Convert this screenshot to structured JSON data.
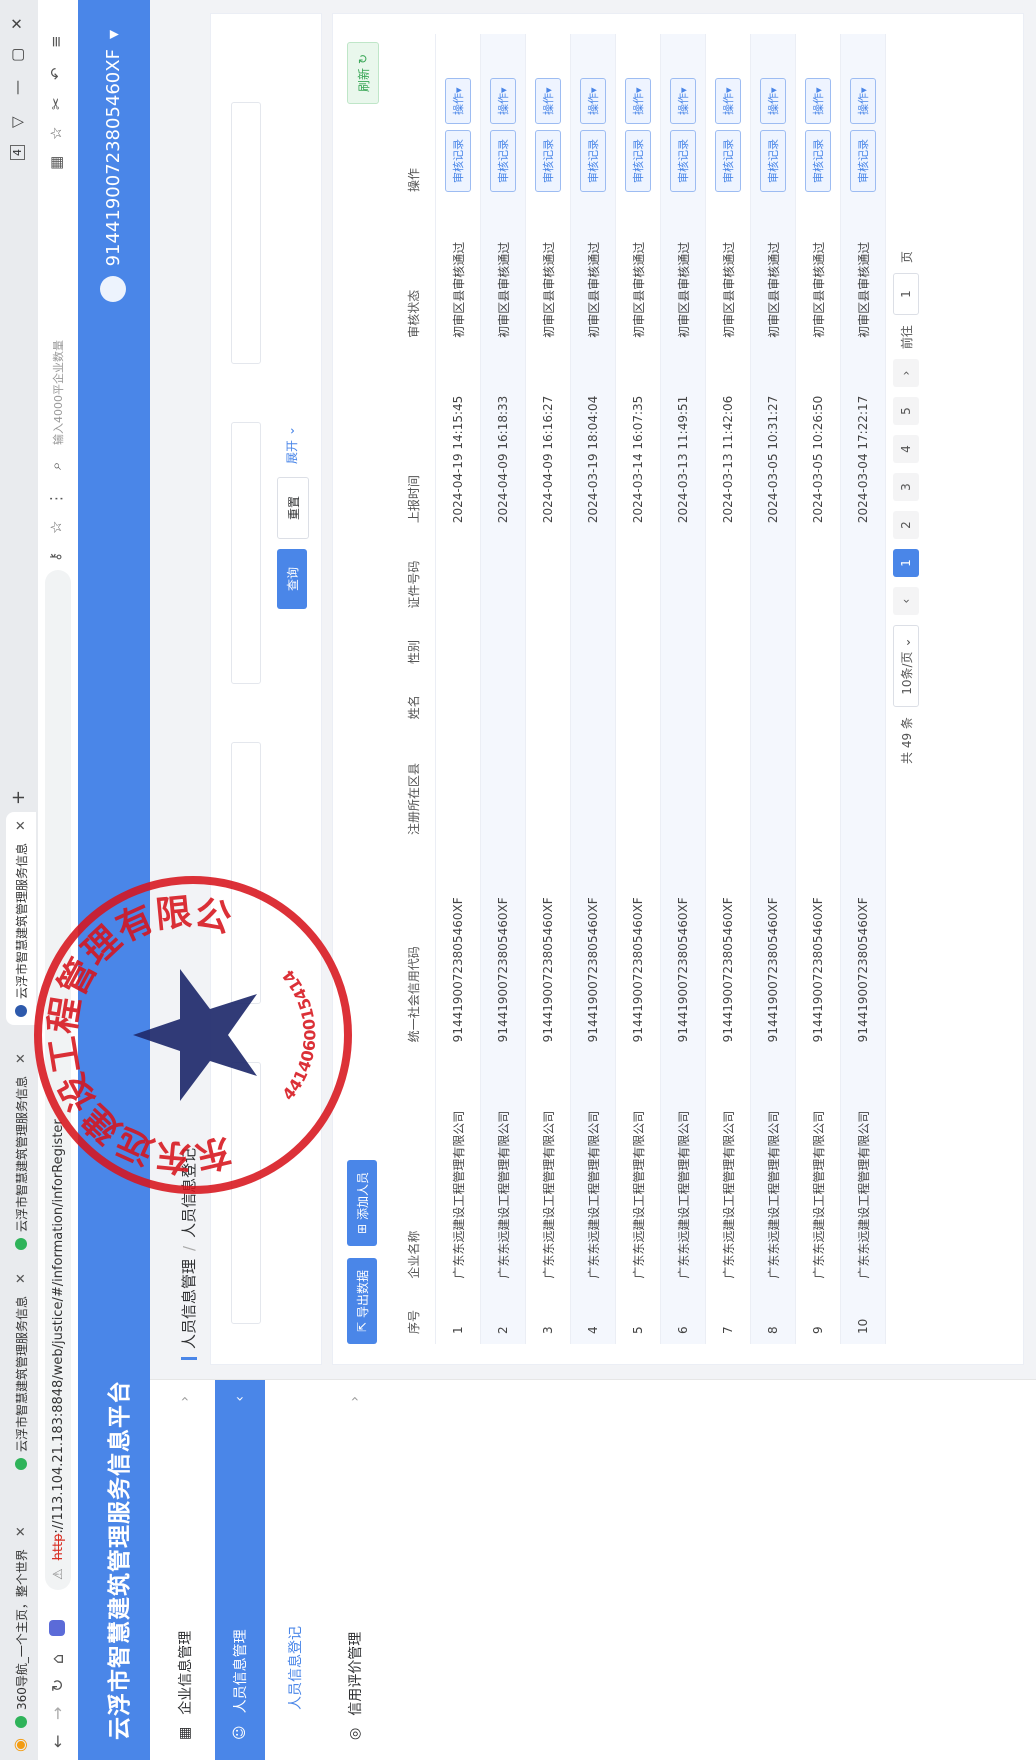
{
  "browser": {
    "tabs": [
      {
        "label": "360导航_一个主页，整个世界"
      },
      {
        "label": "云浮市智慧建筑管理服务信息"
      },
      {
        "label": "云浮市智慧建筑管理服务信息"
      },
      {
        "label": "云浮市智慧建筑管理服务信息"
      }
    ],
    "url_scheme": "http",
    "url_rest": "://113.104.21.183:8848/web/justice/#/information/inforRegister",
    "search_placeholder": "输入4000平企业数量",
    "tab_count": "4"
  },
  "app": {
    "title": "云浮市智慧建筑管理服务信息平台",
    "user_code": "91441900723805460XF",
    "user_arrow": "▾"
  },
  "sidebar": {
    "items": [
      {
        "label": "企业信息管理"
      },
      {
        "label": "人员信息管理"
      },
      {
        "label": "人员信息登记"
      },
      {
        "label": "信用评价管理"
      }
    ]
  },
  "breadcrumb": {
    "parent": "人员信息管理",
    "sep": "/",
    "current": "人员信息登记"
  },
  "search": {
    "query": "查询",
    "reset": "重置",
    "expand": "展开"
  },
  "toolbar": {
    "export": "导出数据",
    "add": "添加人员",
    "refresh": "刷新"
  },
  "table": {
    "headers": [
      "序号",
      "企业名称",
      "统一社会信用代码",
      "注册所在区县",
      "姓名",
      "性别",
      "证件号码",
      "上报时间",
      "审核状态",
      "操作"
    ],
    "rows": [
      {
        "idx": "1",
        "company": "广东东远建设工程管理有限公司",
        "code": "91441900723805460XF",
        "time": "2024-04-19 14:15:45",
        "status": "初审区县审核通过"
      },
      {
        "idx": "2",
        "company": "广东东远建设工程管理有限公司",
        "code": "91441900723805460XF",
        "time": "2024-04-09 16:18:33",
        "status": "初审区县审核通过"
      },
      {
        "idx": "3",
        "company": "广东东远建设工程管理有限公司",
        "code": "91441900723805460XF",
        "time": "2024-04-09 16:16:27",
        "status": "初审区县审核通过"
      },
      {
        "idx": "4",
        "company": "广东东远建设工程管理有限公司",
        "code": "91441900723805460XF",
        "time": "2024-03-19 18:04:04",
        "status": "初审区县审核通过"
      },
      {
        "idx": "5",
        "company": "广东东远建设工程管理有限公司",
        "code": "91441900723805460XF",
        "time": "2024-03-14 16:07:35",
        "status": "初审区县审核通过"
      },
      {
        "idx": "6",
        "company": "广东东远建设工程管理有限公司",
        "code": "91441900723805460XF",
        "time": "2024-03-13 11:49:51",
        "status": "初审区县审核通过"
      },
      {
        "idx": "7",
        "company": "广东东远建设工程管理有限公司",
        "code": "91441900723805460XF",
        "time": "2024-03-13 11:42:06",
        "status": "初审区县审核通过"
      },
      {
        "idx": "8",
        "company": "广东东远建设工程管理有限公司",
        "code": "91441900723805460XF",
        "time": "2024-03-05 10:31:27",
        "status": "初审区县审核通过"
      },
      {
        "idx": "9",
        "company": "广东东远建设工程管理有限公司",
        "code": "91441900723805460XF",
        "time": "2024-03-05 10:26:50",
        "status": "初审区县审核通过"
      },
      {
        "idx": "10",
        "company": "广东东远建设工程管理有限公司",
        "code": "91441900723805460XF",
        "time": "2024-03-04 17:22:17",
        "status": "初审区县审核通过"
      }
    ],
    "op_audit": "审核记录",
    "op_more": "操作▾"
  },
  "pagination": {
    "total": "共 49 条",
    "page_size": "10条/页",
    "pages": [
      "1",
      "2",
      "3",
      "4",
      "5"
    ],
    "goto_label": "前往",
    "goto_value": "1",
    "page_unit": "页"
  },
  "stamp": {
    "text": "广东东远建设工程管理有限公司",
    "number": "4414060015414",
    "color": "#d7141c"
  }
}
